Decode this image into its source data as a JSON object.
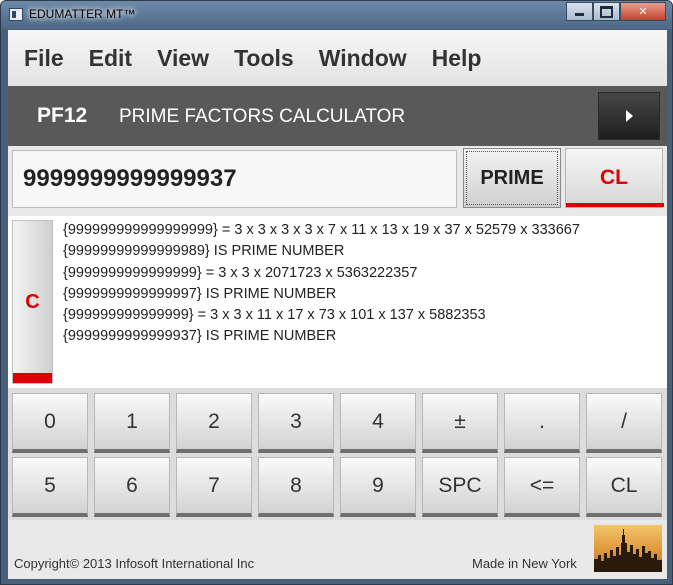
{
  "window": {
    "title": "EDUMATTER MT™",
    "close_glyph": "✕"
  },
  "menu": {
    "items": [
      "File",
      "Edit",
      "View",
      "Tools",
      "Window",
      "Help"
    ]
  },
  "header": {
    "code": "PF12",
    "subtitle": "PRIME FACTORS CALCULATOR"
  },
  "input": {
    "value": "9999999999999937"
  },
  "buttons": {
    "prime": "PRIME",
    "clear_all": "CL",
    "clear": "C"
  },
  "results": [
    "{999999999999999999} = 3 x 3 x 3 x 3 x 7 x 11 x 13 x 19 x 37 x 52579 x 333667",
    "{99999999999999989} IS PRIME NUMBER",
    "{9999999999999999} = 3 x 3 x 2071723 x 5363222357",
    "{9999999999999997} IS PRIME NUMBER",
    "{999999999999999} = 3 x 3 x 11 x 17 x 73 x 101 x 137 x 5882353",
    "{9999999999999937} IS PRIME NUMBER"
  ],
  "keypad": {
    "row1": [
      "0",
      "1",
      "2",
      "3",
      "4",
      "±",
      ".",
      "/"
    ],
    "row2": [
      "5",
      "6",
      "7",
      "8",
      "9",
      "SPC",
      "<=",
      "CL"
    ]
  },
  "footer": {
    "copyright": "Copyright© 2013 Infosoft International Inc",
    "made_in": "Made in New York"
  },
  "colors": {
    "accent_red": "#e00000",
    "header_bg": "#595959",
    "title_bar": "#4d6886"
  }
}
